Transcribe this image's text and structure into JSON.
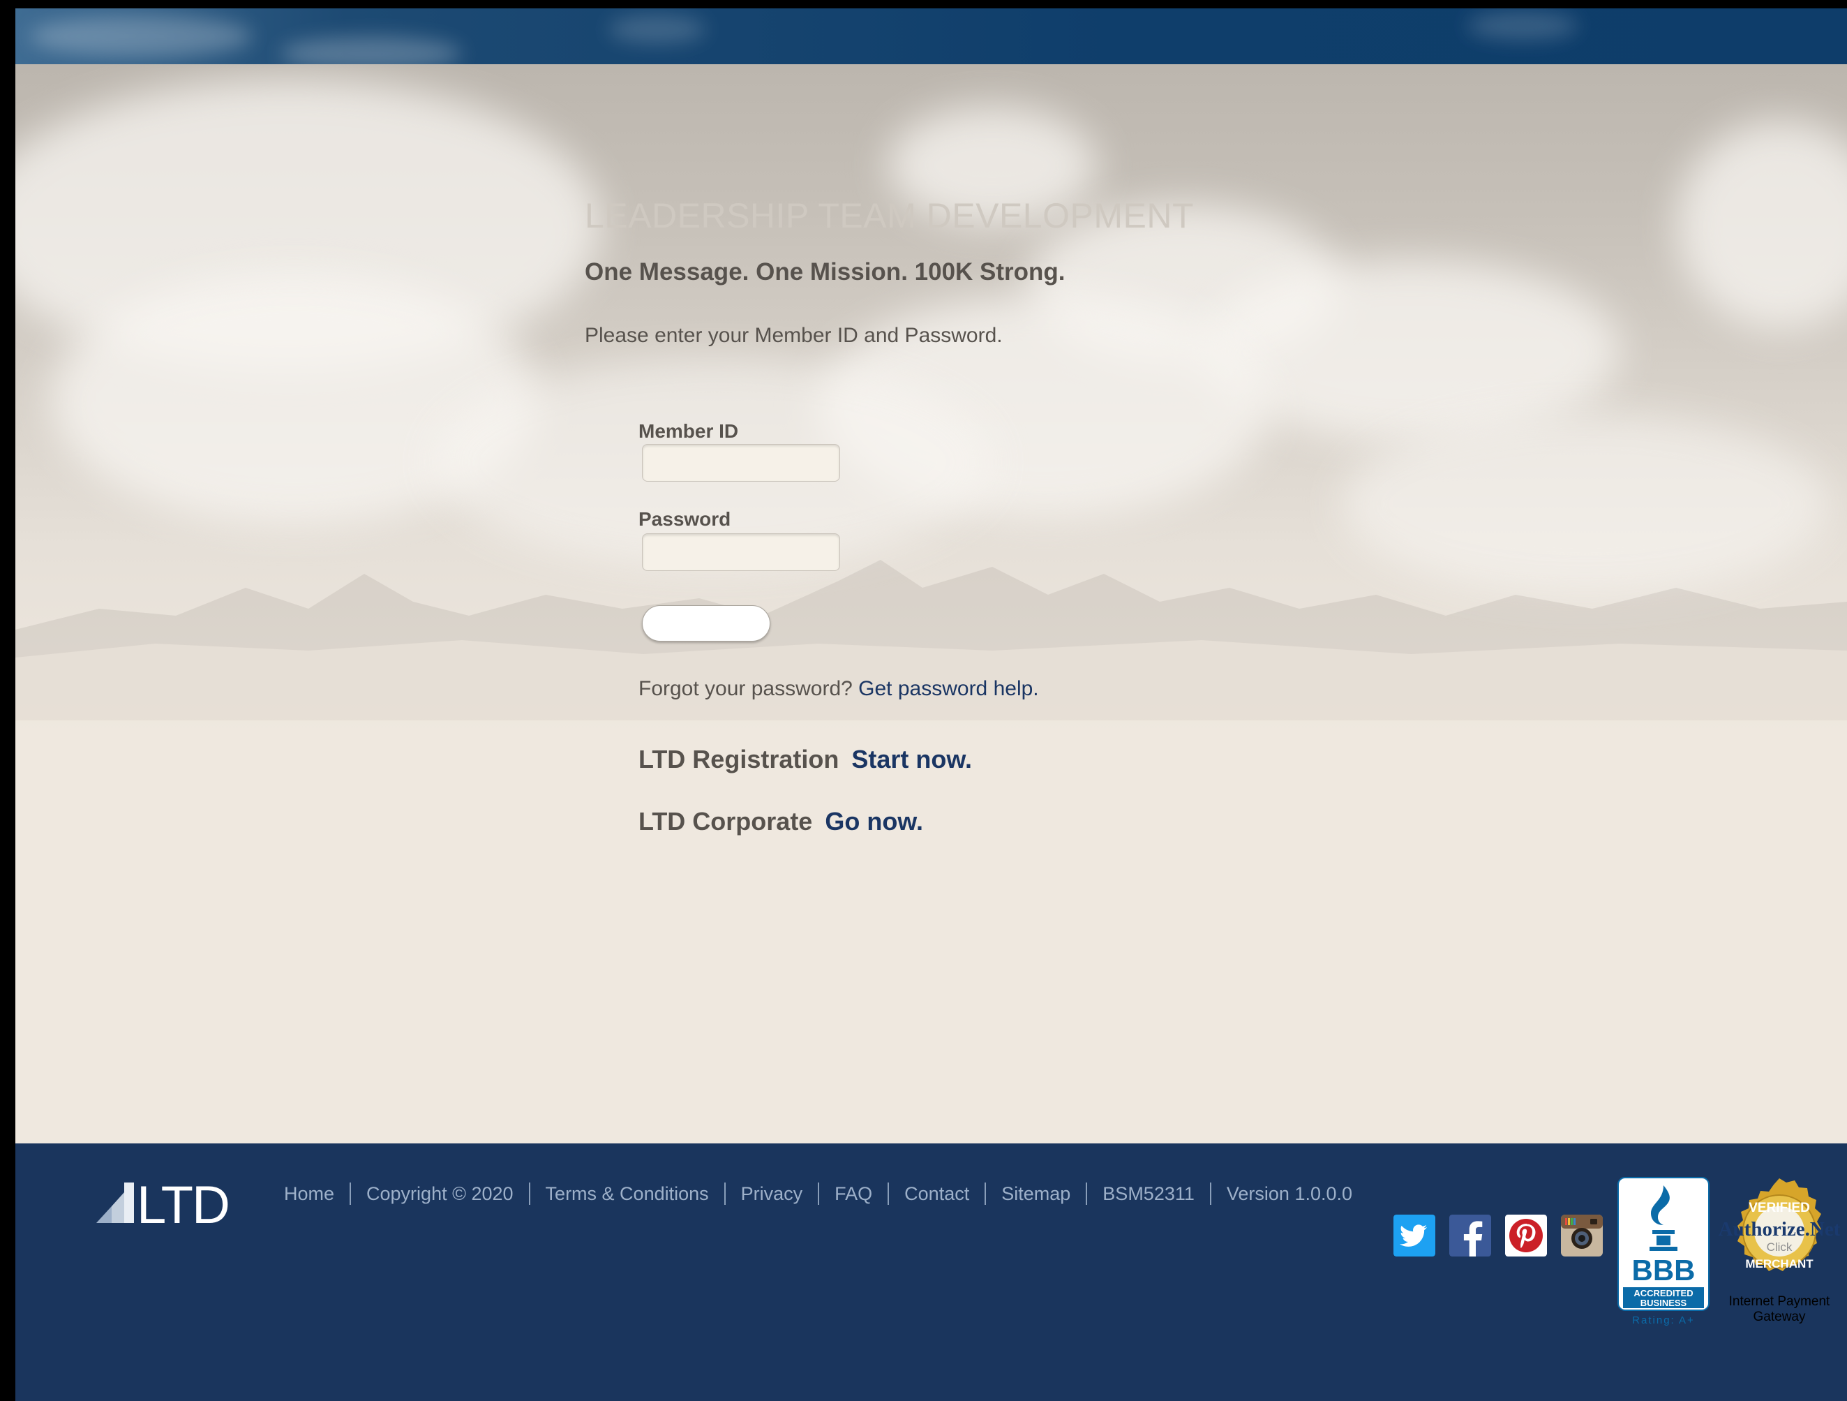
{
  "header": {
    "brand_title": "LEADERSHIP TEAM DEVELOPMENT",
    "tagline": "One Message. One Mission. 100K Strong.",
    "instructions": "Please enter your Member ID and Password."
  },
  "login_form": {
    "member_id_label": "Member ID",
    "member_id_value": "",
    "password_label": "Password",
    "password_value": "",
    "login_button_label": ""
  },
  "help": {
    "forgot_text": "Forgot your password?",
    "forgot_link": "Get password help."
  },
  "promos": {
    "registration_label": "LTD Registration",
    "registration_link": "Start now.",
    "corporate_label": "LTD Corporate",
    "corporate_link": "Go now."
  },
  "footer": {
    "logo_text": "LTD",
    "links": [
      "Home",
      "Copyright © 2020",
      "Terms & Conditions",
      "Privacy",
      "FAQ",
      "Contact",
      "Sitemap",
      "BSM52311",
      "Version 1.0.0.0"
    ],
    "social_icons": [
      "twitter-icon",
      "facebook-icon",
      "pinterest-icon",
      "instagram-icon"
    ],
    "bbb": {
      "title": "BBB",
      "line1": "ACCREDITED",
      "line2": "BUSINESS",
      "rating": "Rating: A+"
    },
    "authorize_net": {
      "top": "VERIFIED",
      "brand": "Authorize.Net",
      "click": "Click",
      "bottom": "MERCHANT",
      "caption_line1": "Internet Payment",
      "caption_line2": "Gateway"
    }
  },
  "colors": {
    "footer_bg": "#1a355d",
    "link": "#1a3563",
    "text": "#57524d",
    "twitter": "#1da1f2",
    "facebook": "#3b5998",
    "pinterest": "#cb2027"
  }
}
